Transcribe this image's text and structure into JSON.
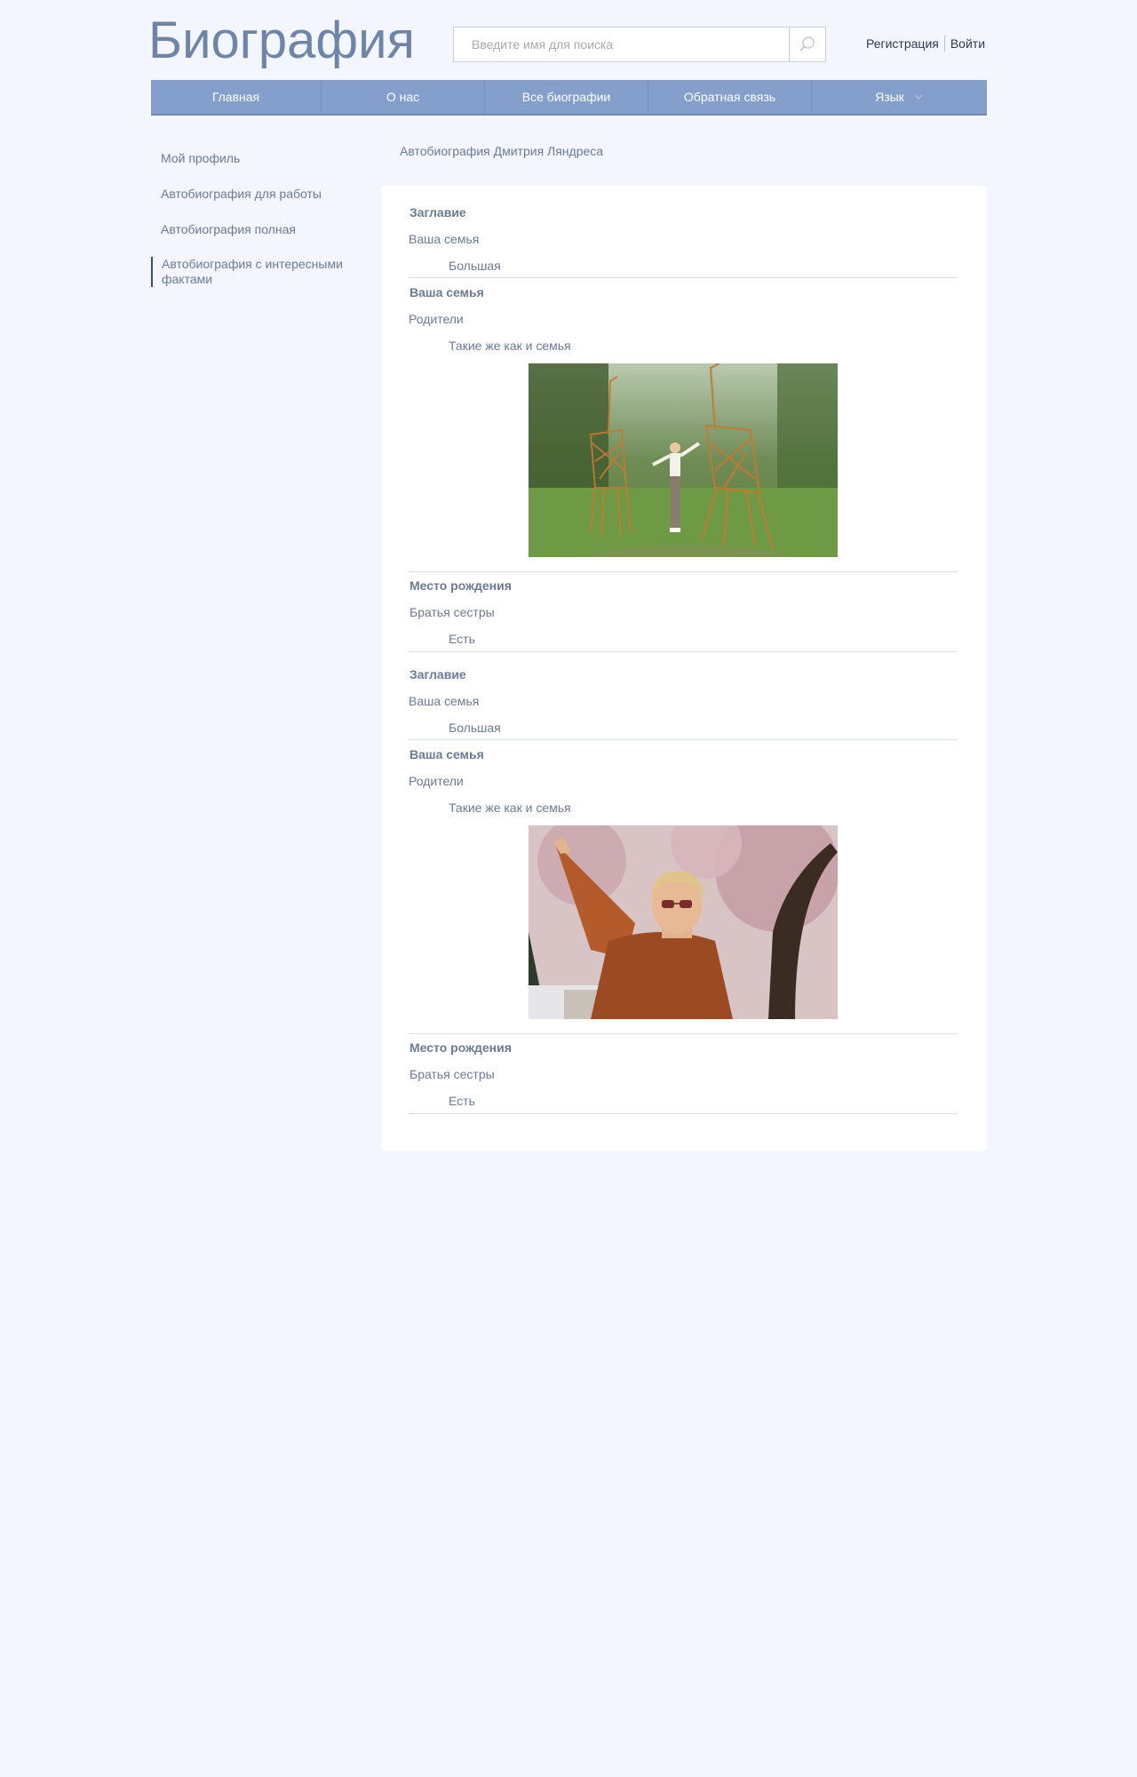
{
  "header": {
    "logo": "Биография",
    "search_placeholder": "Введите имя для поиска",
    "register": "Регистрация",
    "login": "Войти"
  },
  "nav": {
    "items": [
      "Главная",
      "О нас",
      "Все биографии",
      "Обратная связь",
      "Язык"
    ]
  },
  "sidebar": {
    "items": [
      "Мой профиль",
      "Автобиография для работы",
      "Автобиография полная",
      "Автобиография с интересными фактами"
    ]
  },
  "breadcrumb": "Автобиография Дмитрия Ляндреса",
  "content": {
    "block1": {
      "h1": "Заглавие",
      "t1": "Ваша семья",
      "i1": "Большая",
      "h2": "Ваша семья",
      "t2": "Родители",
      "i2": "Такие же как и семья",
      "h3": "Место рождения",
      "t3": "Братья сестры",
      "i3": "Есть"
    },
    "block2": {
      "h1": "Заглавие",
      "t1": "Ваша семья",
      "i1": "Большая",
      "h2": "Ваша семья",
      "t2": "Родители",
      "i2": "Такие же как и семья",
      "h3": "Место рождения",
      "t3": "Братья сестры",
      "i3": "Есть"
    }
  }
}
